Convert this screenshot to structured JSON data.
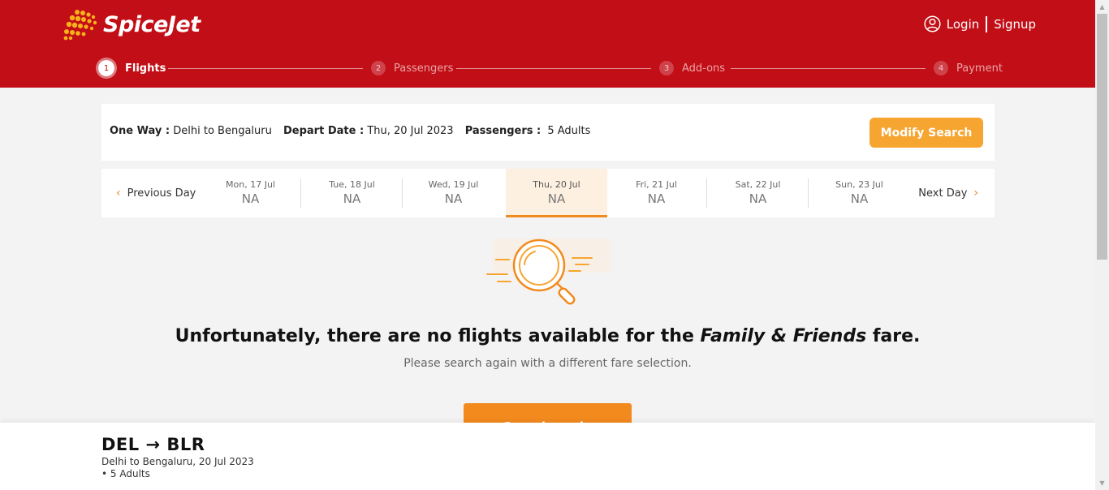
{
  "brand": {
    "name": "SpiceJet"
  },
  "auth": {
    "login": "Login",
    "signup": "Signup"
  },
  "steps": [
    {
      "num": "1",
      "label": "Flights"
    },
    {
      "num": "2",
      "label": "Passengers"
    },
    {
      "num": "3",
      "label": "Add-ons"
    },
    {
      "num": "4",
      "label": "Payment"
    }
  ],
  "summary": {
    "trip_label": "One Way :",
    "trip_value": "Delhi to Bengaluru",
    "depart_label": "Depart Date :",
    "depart_value": "Thu, 20 Jul 2023",
    "pax_label": "Passengers :",
    "pax_value": "5 Adults",
    "modify_button": "Modify Search"
  },
  "datestrip": {
    "prev": "Previous Day",
    "next": "Next Day",
    "days": [
      {
        "label": "Mon, 17 Jul",
        "fare": "NA"
      },
      {
        "label": "Tue, 18 Jul",
        "fare": "NA"
      },
      {
        "label": "Wed, 19 Jul",
        "fare": "NA"
      },
      {
        "label": "Thu, 20 Jul",
        "fare": "NA"
      },
      {
        "label": "Fri, 21 Jul",
        "fare": "NA"
      },
      {
        "label": "Sat, 22 Jul",
        "fare": "NA"
      },
      {
        "label": "Sun, 23 Jul",
        "fare": "NA"
      }
    ],
    "selected_index": 3
  },
  "empty_state": {
    "message_start": "Unfortunately, there are no flights available for the",
    "fare_name": "Family & Friends",
    "message_end": "fare.",
    "hint": "Please search again with a different fare selection.",
    "button": "Search again"
  },
  "bottom": {
    "route": "DEL → BLR",
    "details": "Delhi to Bengaluru, 20 Jul 2023",
    "pax": "• 5 Adults"
  },
  "colors": {
    "header": "#c20e16",
    "accent": "#f28a1e",
    "modify": "#f7a531",
    "selected_day_bg": "#fdf0e0"
  }
}
